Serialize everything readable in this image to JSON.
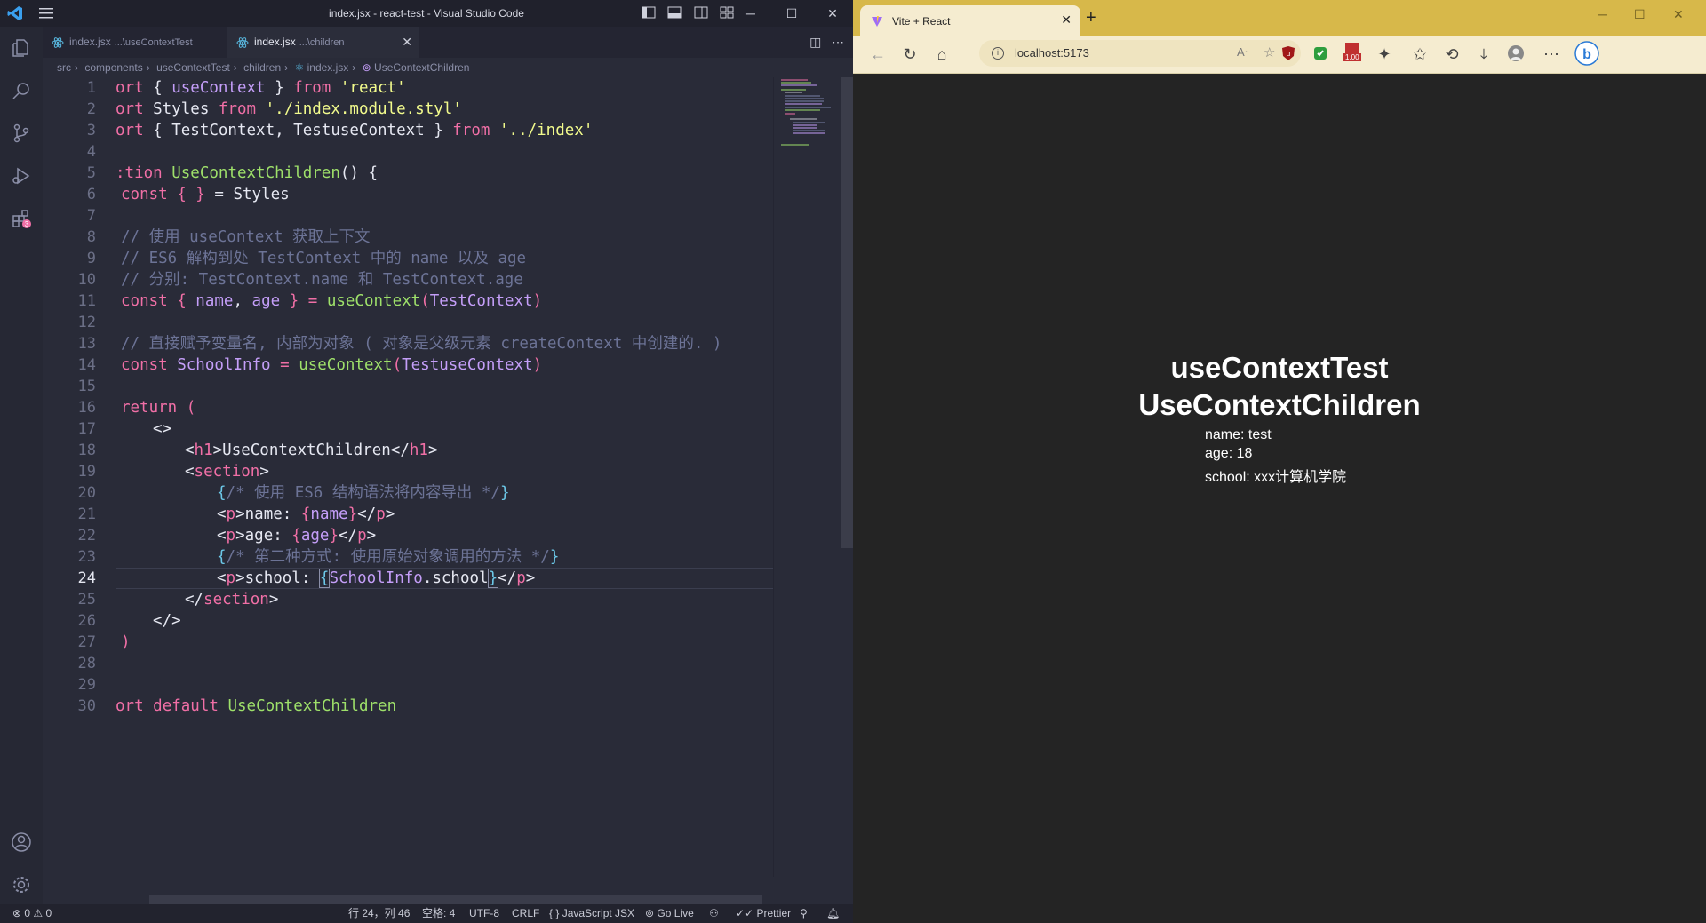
{
  "vscode": {
    "title": "index.jsx - react-test - Visual Studio Code",
    "tabs": [
      {
        "label": "index.jsx",
        "desc": "...\\useContextTest",
        "active": false
      },
      {
        "label": "index.jsx",
        "desc": "...\\children",
        "active": true
      }
    ],
    "breadcrumb": [
      "src",
      "components",
      "useContextTest",
      "children",
      "index.jsx",
      "UseContextChildren"
    ],
    "current_line": 24,
    "line_numbers": [
      "1",
      "2",
      "3",
      "4",
      "5",
      "6",
      "7",
      "8",
      "9",
      "10",
      "11",
      "12",
      "13",
      "14",
      "15",
      "16",
      "17",
      "18",
      "19",
      "20",
      "21",
      "22",
      "23",
      "24",
      "25",
      "26",
      "27",
      "28",
      "29",
      "30"
    ],
    "code": {
      "l1": [
        "ort",
        " { ",
        "useContext",
        " } ",
        "from",
        " ",
        "'react'"
      ],
      "l2": [
        "ort",
        " Styles ",
        "from",
        " ",
        "'./index.module.styl'"
      ],
      "l3": [
        "ort",
        " { TestContext, TestuseContext } ",
        "from",
        " ",
        "'../index'"
      ],
      "l5": [
        ":tion",
        " ",
        "UseContextChildren",
        "() {"
      ],
      "l6": [
        "const",
        " ",
        "{ }",
        " = Styles"
      ],
      "l8": "// 使用 useContext 获取上下文",
      "l9": "// ES6 解构到处 TestContext 中的 name 以及 age",
      "l10": "// 分别: TestContext.name 和 TestContext.age",
      "l11": [
        "const",
        " { ",
        "name",
        ", ",
        "age",
        " } = ",
        "useContext",
        "(",
        "TestContext",
        ")"
      ],
      "l13": "// 直接赋予变量名, 内部为对象 ( 对象是父级元素 createContext 中创建的. )",
      "l14": [
        "const",
        " ",
        "SchoolInfo",
        " = ",
        "useContext",
        "(",
        "TestuseContext",
        ")"
      ],
      "l16": [
        "return",
        " ("
      ],
      "l17": "<>",
      "l18": [
        "<",
        "h1",
        ">UseContextChildren</",
        "h1",
        ">"
      ],
      "l19": [
        "<",
        "section",
        ">"
      ],
      "l20": [
        "{",
        "/* 使用 ES6 结构语法将内容导出 */",
        "}"
      ],
      "l21": [
        "<",
        "p",
        ">name: ",
        "{",
        "name",
        "}",
        "</",
        "p",
        ">"
      ],
      "l22": [
        "<",
        "p",
        ">age: ",
        "{",
        "age",
        "}",
        "</",
        "p",
        ">"
      ],
      "l23": [
        "{",
        "/* 第二种方式: 使用原始对象调用的方法 */",
        "}"
      ],
      "l24": [
        "<",
        "p",
        ">school: ",
        "{",
        "SchoolInfo",
        ".school",
        "}",
        "</",
        "p",
        ">"
      ],
      "l25": [
        "</",
        "section",
        ">"
      ],
      "l26": "</>",
      "l27": ")",
      "l30": [
        "ort",
        " ",
        "default",
        " ",
        "UseContextChildren"
      ]
    },
    "status": {
      "errors": "0",
      "warnings": "0",
      "position": "行 24，列 46",
      "spaces": "空格: 4",
      "encoding": "UTF-8",
      "eol": "CRLF",
      "language": "JavaScript JSX",
      "golive": "Go Live",
      "prettier": "Prettier"
    },
    "colors": {
      "bg": "#292b38",
      "keyword": "#f06fa6",
      "string": "#f1fa8c",
      "function": "#9ee06a",
      "variable": "#c49ef8",
      "comment": "#6c7396"
    }
  },
  "browser": {
    "tab_title": "Vite + React",
    "address": "localhost:5173",
    "badge": "1.00",
    "page": {
      "h1_parent": "useContextTest",
      "h1_child": "UseContextChildren",
      "name_line": "name: test",
      "age_line": "age: 18",
      "school_line": "school: xxx计算机学院"
    },
    "colors": {
      "tabbar": "#d7b84a",
      "toolbar": "#f5ecd0",
      "content_bg": "#242424"
    }
  }
}
